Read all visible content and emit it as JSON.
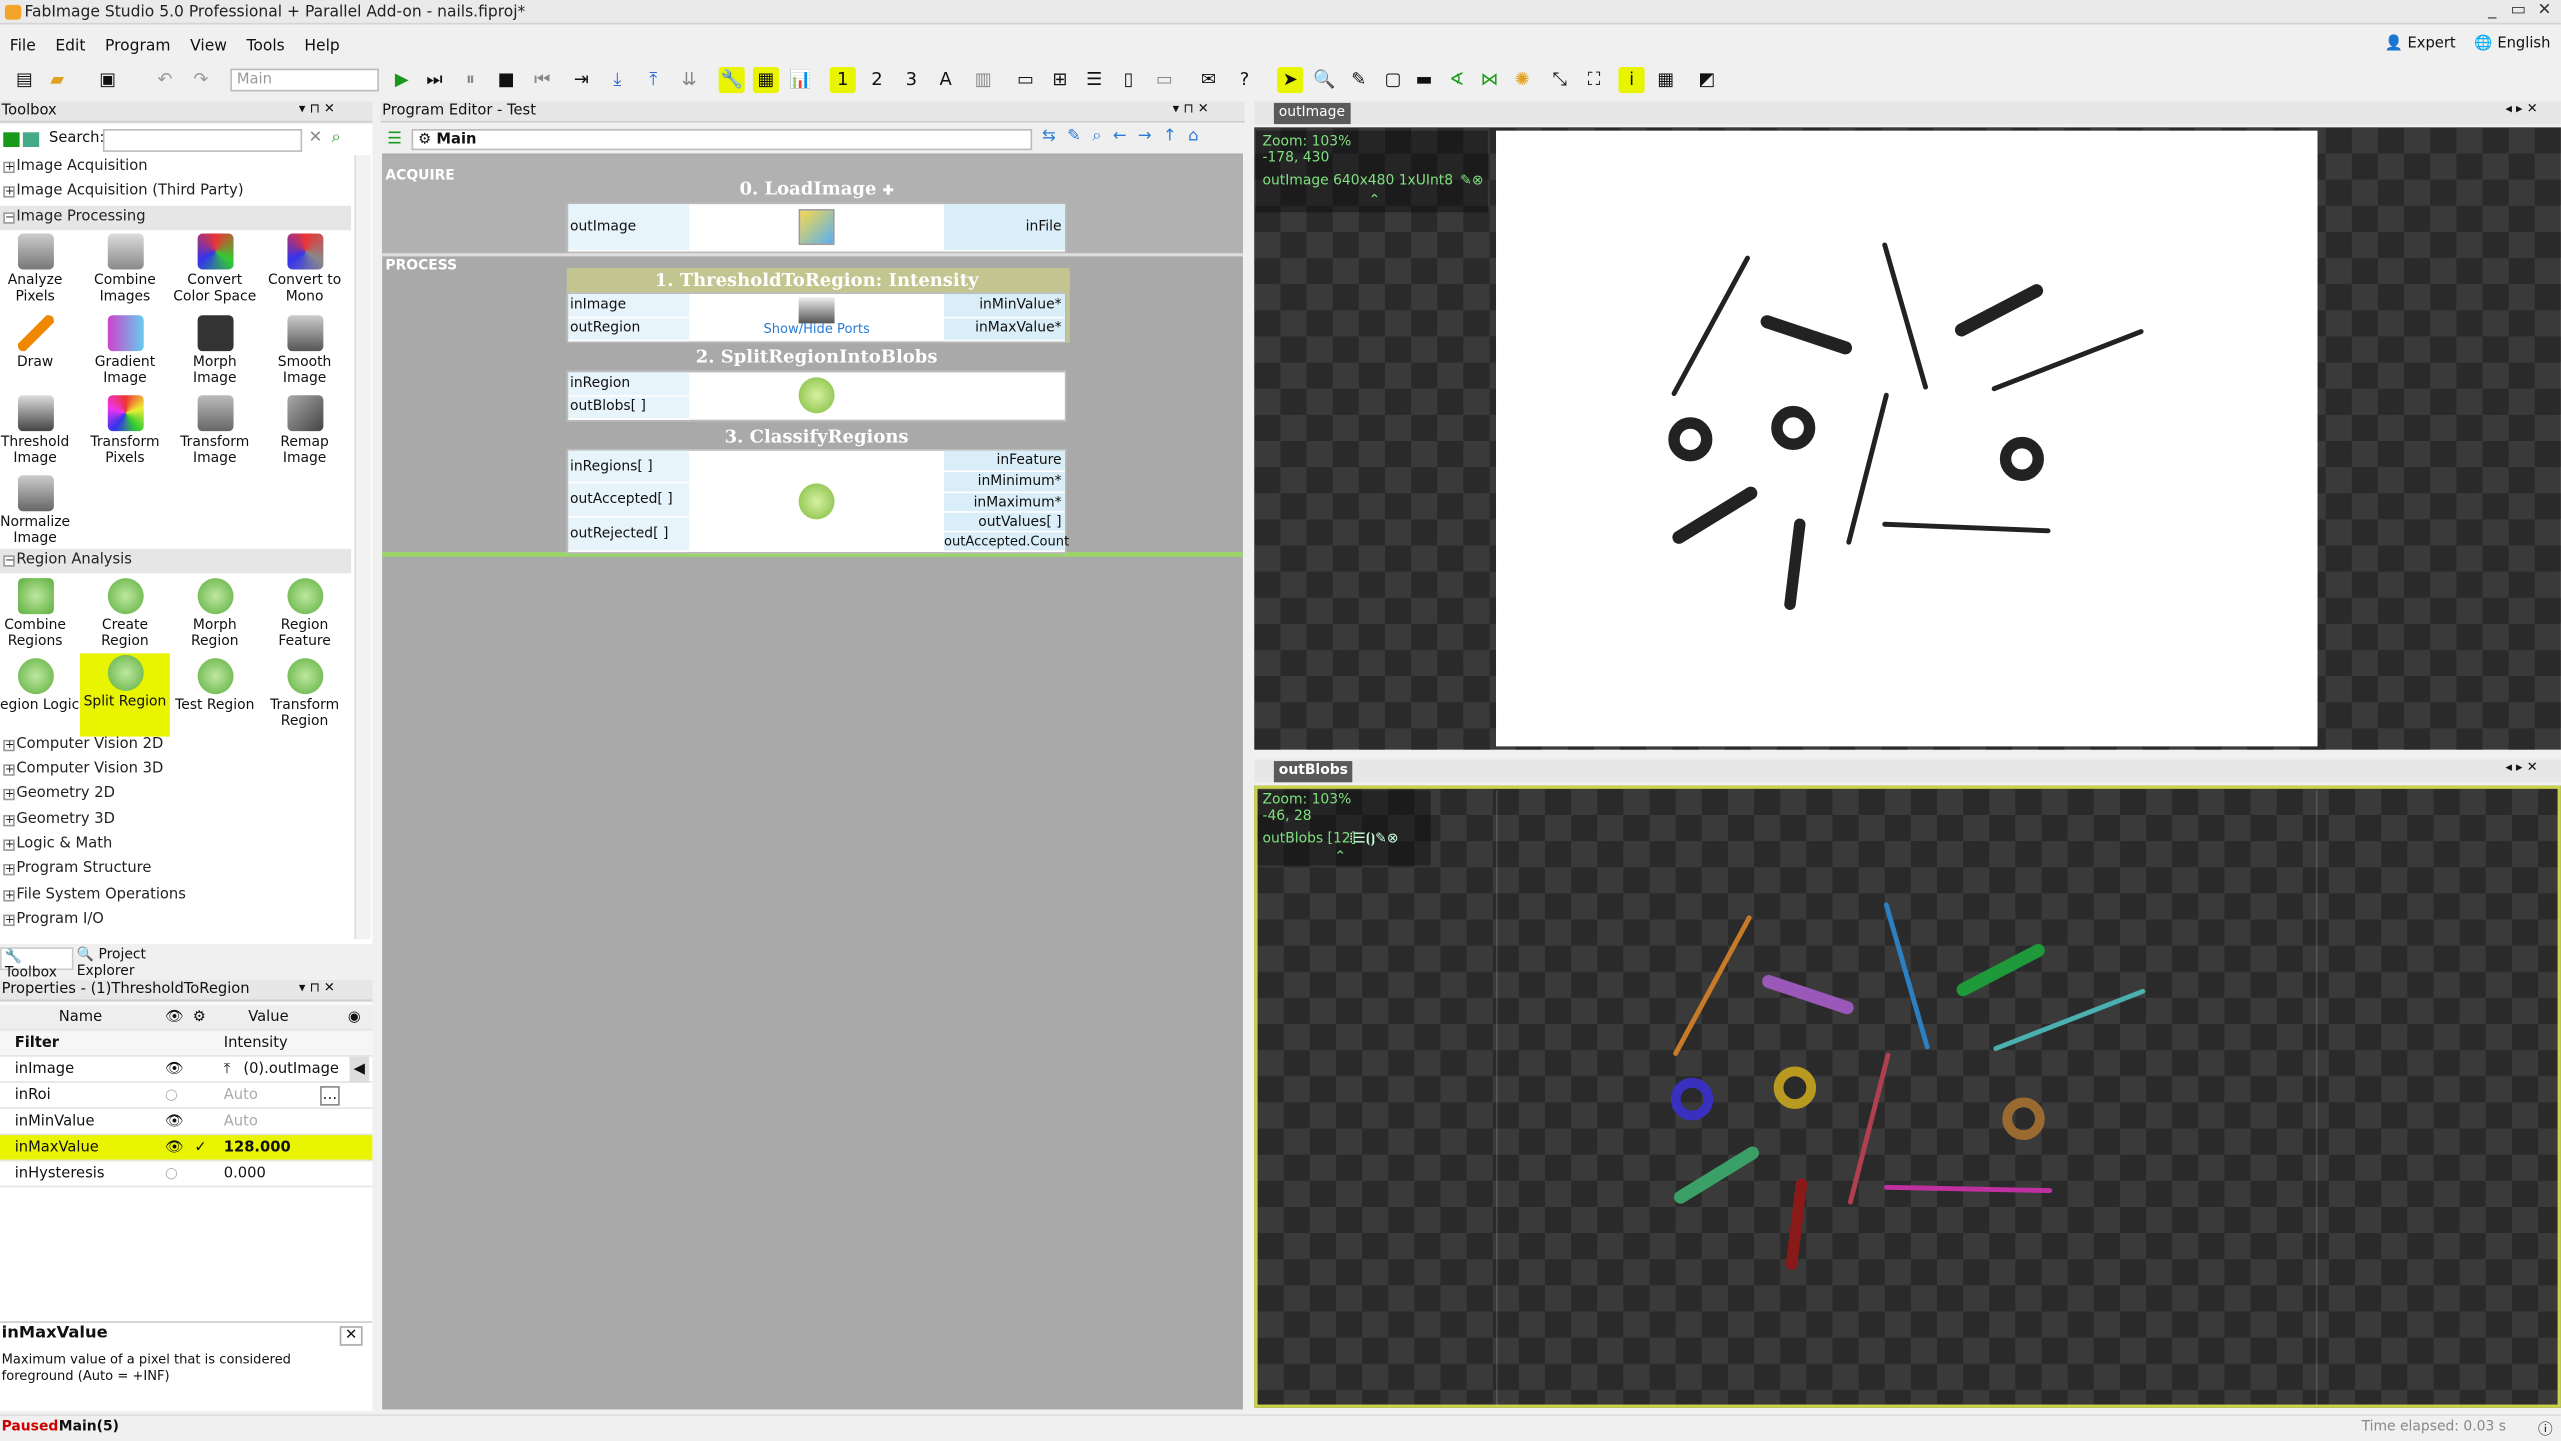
{
  "window": {
    "title": "FabImage Studio 5.0 Professional + Parallel Add-on - nails.fiproj*",
    "controls": [
      "_",
      "▭",
      "✕"
    ]
  },
  "menu": [
    "File",
    "Edit",
    "Program",
    "View",
    "Tools",
    "Help"
  ],
  "mode": {
    "expert": "Expert",
    "language": "English"
  },
  "toolbar": {
    "combo": "Main"
  },
  "toolbox": {
    "header": "Toolbox",
    "search_label": "Search:",
    "groups": {
      "g1": "Image Acquisition",
      "g2": "Image Acquisition (Third Party)",
      "g3": "Image Processing",
      "g4": "Region Analysis",
      "g5": "Computer Vision 2D",
      "g6": "Computer Vision 3D",
      "g7": "Geometry 2D",
      "g8": "Geometry 3D",
      "g9": "Logic & Math",
      "g10": "Program Structure",
      "g11": "File System Operations",
      "g12": "Program I/O"
    },
    "ip": {
      "t1": "Analyze Pixels",
      "t2": "Combine Images",
      "t3": "Convert Color Space",
      "t4": "Convert to Mono",
      "t5": "Draw",
      "t6": "Gradient Image",
      "t7": "Morph Image",
      "t8": "Smooth Image",
      "t9": "Threshold Image",
      "t10": "Transform Pixels",
      "t11": "Transform Image",
      "t12": "Remap Image",
      "t13": "Normalize Image"
    },
    "ra": {
      "t1": "Combine Regions",
      "t2": "Create Region",
      "t3": "Morph Region",
      "t4": "Region Feature",
      "t5": "Region Logic",
      "t6": "Split Region",
      "t7": "Test Region",
      "t8": "Transform Region"
    },
    "tabs": {
      "toolbox": "Toolbox",
      "explorer": "Project Explorer"
    }
  },
  "properties": {
    "header": "Properties - (1)ThresholdToRegion",
    "col_name": "Name",
    "col_value": "Value",
    "rows": [
      {
        "name": "Filter",
        "value": "Intensity"
      },
      {
        "name": "inImage",
        "value": "(0).outImage"
      },
      {
        "name": "inRoi",
        "value": "Auto"
      },
      {
        "name": "inMinValue",
        "value": "Auto"
      },
      {
        "name": "inMaxValue",
        "value": "128.000"
      },
      {
        "name": "inHysteresis",
        "value": "0.000"
      }
    ],
    "help_title": "inMaxValue",
    "help_text": "Maximum value of a pixel that is considered foreground (Auto = +INF)"
  },
  "editor": {
    "header": "Program Editor - Test",
    "main": "Main",
    "sec1": "ACQUIRE",
    "sec2": "PROCESS",
    "b0": {
      "title": "0. LoadImage",
      "out": "outImage",
      "in": "inFile"
    },
    "b1": {
      "title": "1. ThresholdToRegion: Intensity",
      "p1": "inImage",
      "p2": "outRegion",
      "r1": "inMinValue*",
      "r2": "inMaxValue*",
      "link": "Show/Hide Ports"
    },
    "b2": {
      "title": "2. SplitRegionIntoBlobs",
      "p1": "inRegion",
      "p2": "outBlobs[ ]"
    },
    "b3": {
      "title": "3. ClassifyRegions",
      "p1": "inRegions[ ]",
      "p2": "outAccepted[ ]",
      "p3": "outRejected[ ]",
      "r1": "inFeature",
      "r2": "inMinimum*",
      "r3": "inMaximum*",
      "r4": "outValues[ ]",
      "r5": "outAccepted.Count"
    }
  },
  "view1": {
    "tab": "outImage",
    "zoom": "Zoom: 103%",
    "coords": "-178, 430",
    "info": "outImage 640x480 1xUInt8"
  },
  "view2": {
    "tab": "outBlobs",
    "zoom": "Zoom: 103%",
    "coords": "-46, 28",
    "info": "outBlobs [12]"
  },
  "status": {
    "state": "Paused",
    "ctx": "Main(5)",
    "elapsed": "Time elapsed: 0.03 s"
  },
  "colors": {
    "highlight": "#e8f400",
    "link": "#2a7bd6"
  }
}
